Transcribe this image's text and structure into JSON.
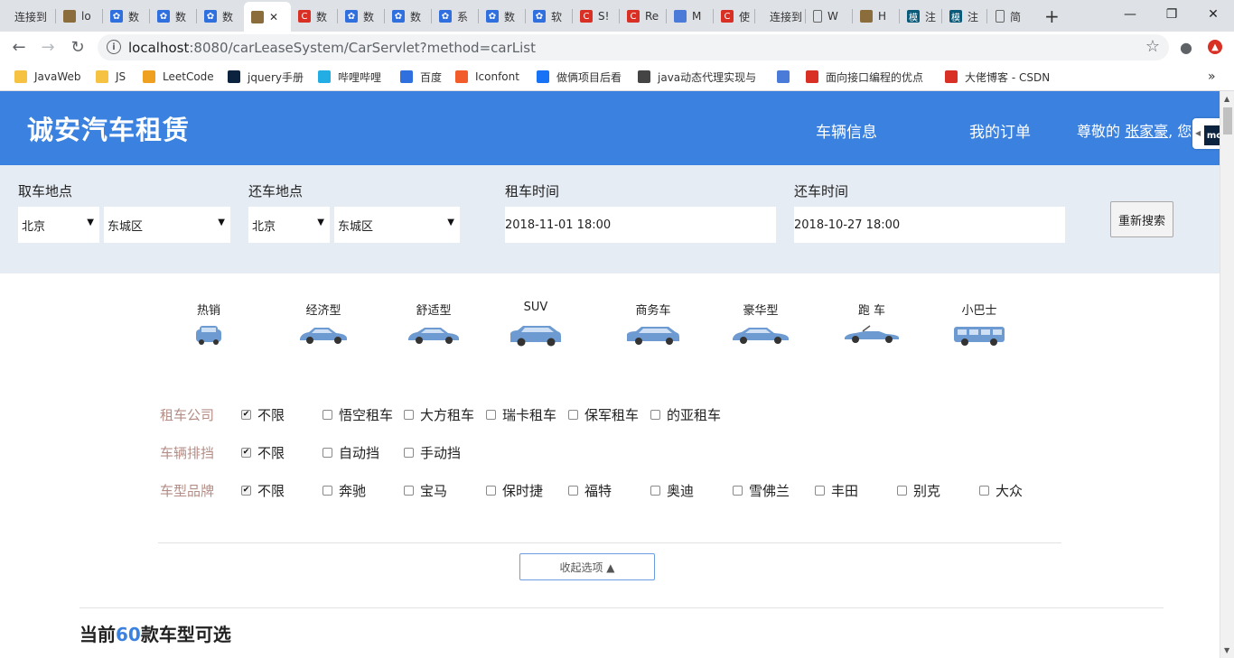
{
  "browser": {
    "tabs": [
      {
        "label": "连接到",
        "icon": "text",
        "color": "#dee1e6"
      },
      {
        "label": "lo",
        "icon": "image-icon",
        "color": "#8a6d3b"
      },
      {
        "label": "数",
        "icon": "paw-icon",
        "color": "#2f6fde"
      },
      {
        "label": "数",
        "icon": "paw-icon",
        "color": "#2f6fde"
      },
      {
        "label": "数",
        "icon": "paw-icon",
        "color": "#2f6fde"
      },
      {
        "label": "✕",
        "icon": "image-icon",
        "color": "#8a6d3b"
      },
      {
        "label": "数",
        "icon": "csdn-icon",
        "color": "#d93025"
      },
      {
        "label": "数",
        "icon": "paw-icon",
        "color": "#2f6fde"
      },
      {
        "label": "数",
        "icon": "paw-icon",
        "color": "#2f6fde"
      },
      {
        "label": "系",
        "icon": "paw-icon",
        "color": "#2f6fde"
      },
      {
        "label": "数",
        "icon": "paw-icon",
        "color": "#2f6fde"
      },
      {
        "label": "软",
        "icon": "paw-icon",
        "color": "#2f6fde"
      },
      {
        "label": "S!",
        "icon": "csdn-icon",
        "color": "#d93025"
      },
      {
        "label": "Re",
        "icon": "csdn-icon",
        "color": "#d93025"
      },
      {
        "label": "M",
        "icon": "quill-icon",
        "color": "#4a7bd9"
      },
      {
        "label": "使",
        "icon": "csdn-icon",
        "color": "#d93025"
      },
      {
        "label": "连接到",
        "icon": "text",
        "color": "#dee1e6"
      },
      {
        "label": "W",
        "icon": "page-icon",
        "color": "#dee1e6"
      },
      {
        "label": "H",
        "icon": "image-icon",
        "color": "#8a6d3b"
      },
      {
        "label": "注",
        "icon": "mo-icon",
        "color": "#0a5a7a"
      },
      {
        "label": "注",
        "icon": "mo-icon",
        "color": "#0a5a7a"
      },
      {
        "label": "简",
        "icon": "page-icon",
        "color": "#dee1e6"
      }
    ],
    "new_tab": "+",
    "url_host": "localhost",
    "url_rest": ":8080/carLeaseSystem/CarServlet?method=carList",
    "bookmarks": [
      {
        "label": "JavaWeb",
        "icon": "folder-icon",
        "color": "#f5c242"
      },
      {
        "label": "JS",
        "icon": "folder-icon",
        "color": "#f5c242"
      },
      {
        "label": "LeetCode",
        "icon": "leetcode-icon",
        "color": "#f0a020"
      },
      {
        "label": "jquery手册",
        "icon": "jquery-icon",
        "color": "#0c2340"
      },
      {
        "label": "哔哩哔哩",
        "icon": "bilibili-icon",
        "color": "#23ade5"
      },
      {
        "label": "百度",
        "icon": "paw-icon",
        "color": "#2f6fde"
      },
      {
        "label": "Iconfont",
        "icon": "iconfont-icon",
        "color": "#f25b2a"
      },
      {
        "label": "做俩项目后看",
        "icon": "zhihu-icon",
        "color": "#1772f6"
      },
      {
        "label": "java动态代理实现与",
        "icon": "bird-icon",
        "color": "#444"
      },
      {
        "label": "",
        "icon": "quill-icon",
        "color": "#4a7bd9"
      },
      {
        "label": "面向接口编程的优点",
        "icon": "csdn-icon",
        "color": "#d93025"
      },
      {
        "label": "大佬博客 - CSDN",
        "icon": "csdn-icon",
        "color": "#d93025"
      }
    ],
    "more": "»"
  },
  "header": {
    "brand": "诚安汽车租赁",
    "nav_vehicle": "车辆信息",
    "nav_orders": "我的订单",
    "greet_prefix": "尊敬的 ",
    "user": "张家豪",
    "greet_suffix": ", 您",
    "widget_text": "mc"
  },
  "search": {
    "pickup_label": "取车地点",
    "return_label": "还车地点",
    "rent_time_label": "租车时间",
    "return_time_label": "还车时间",
    "pickup_city": "北京",
    "pickup_district": "东城区",
    "return_city": "北京",
    "return_district": "东城区",
    "rent_time": "2018-11-01 18:00",
    "return_time": "2018-10-27 18:00",
    "button": "重新搜索"
  },
  "car_types": [
    "热销",
    "经济型",
    "舒适型",
    "SUV",
    "商务车",
    "豪华型",
    "跑 车",
    "小巴士"
  ],
  "filters": {
    "company": {
      "label": "租车公司",
      "options": [
        "不限",
        "悟空租车",
        "大方租车",
        "瑞卡租车",
        "保军租车",
        "的亚租车"
      ],
      "checked": [
        0
      ]
    },
    "gearbox": {
      "label": "车辆排挡",
      "options": [
        "不限",
        "自动挡",
        "手动挡"
      ],
      "checked": [
        0
      ]
    },
    "brand": {
      "label": "车型品牌",
      "options": [
        "不限",
        "奔驰",
        "宝马",
        "保时捷",
        "福特",
        "奥迪",
        "雪佛兰",
        "丰田",
        "别克",
        "大众"
      ],
      "checked": [
        0
      ]
    }
  },
  "collapse_button": "收起选项 ▲",
  "count": {
    "prefix": "当前",
    "num": "60",
    "suffix": "款车型可选"
  },
  "colors": {
    "brand_blue": "#3b82e0",
    "search_bg": "#e6ecf4",
    "filter_label": "#b48d86",
    "car_icon": "#6d9bd1"
  }
}
